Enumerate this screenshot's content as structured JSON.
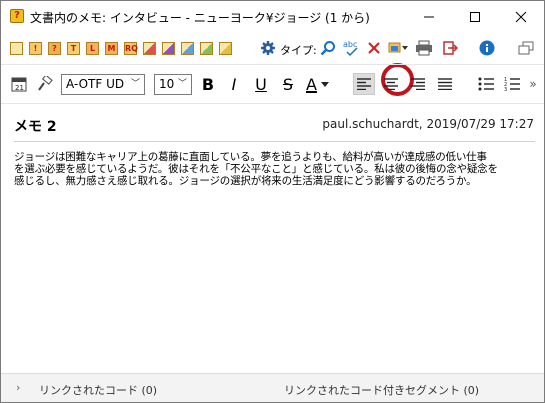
{
  "window": {
    "title": "文書内のメモ: インタビュー - ニューヨーク¥ジョージ (1 から)",
    "title_icon_glyph": "?",
    "controls": {
      "minimize_icon": "minimize-icon",
      "maximize_icon": "maximize-icon",
      "close_icon": "close-icon"
    }
  },
  "toolbar1": {
    "tags": [
      {
        "glyph": "",
        "bg": "#f9e9a8"
      },
      {
        "glyph": "!",
        "bg": "#f7c96a"
      },
      {
        "glyph": "?",
        "bg": "#f0b050"
      },
      {
        "glyph": "T",
        "bg": "#f5d070"
      },
      {
        "glyph": "L",
        "bg": "#f5b060"
      },
      {
        "glyph": "M",
        "bg": "#f5b060"
      },
      {
        "glyph": "RQ",
        "bg": "#f5c070"
      },
      {
        "glyph": "",
        "bg": "#e05050"
      },
      {
        "glyph": "",
        "bg": "#9050c0"
      },
      {
        "glyph": "",
        "bg": "#60a0e0"
      },
      {
        "glyph": "",
        "bg": "#80c060"
      },
      {
        "glyph": "",
        "bg": "#e0c040"
      }
    ],
    "type_label": "タイプ:",
    "spell_glyph": "abc",
    "icons": [
      "gear-icon",
      "search-icon",
      "spellcheck-icon",
      "delete-icon",
      "insert-image-icon",
      "print-icon",
      "export-icon",
      "info-icon",
      "popout-icon"
    ]
  },
  "toolbar2": {
    "font_name": "A-OTF UD",
    "font_size": "10",
    "bold_glyph": "B",
    "italic_glyph": "I",
    "underline_glyph": "U",
    "strike_glyph": "S",
    "color_glyph": "A",
    "more_glyph": "»"
  },
  "memo": {
    "title": "メモ 2",
    "author": "paul.schuchardt",
    "date": "2019/07/29 17:27",
    "body_lines": [
      "ジョージは困難なキャリア上の葛藤に直面している。夢を追うよりも、給料が高いが達成感の低い仕事",
      "を選ぶ必要を感じているようだ。彼はそれを「不公平なこと」と感じている。私は彼の後悔の念や疑念を",
      "感じるし、無力感さえ感じ取れる。ジョージの選択が将来の生活満足度にどう影響するのだろうか。"
    ]
  },
  "footer": {
    "linked_codes": "リンクされたコード (0)",
    "linked_segments": "リンクされたコード付きセグメント (0)"
  },
  "colors": {
    "highlight_circle": "#c0141c",
    "accent_blue": "#1a6fc4",
    "delete_red": "#d02020"
  }
}
